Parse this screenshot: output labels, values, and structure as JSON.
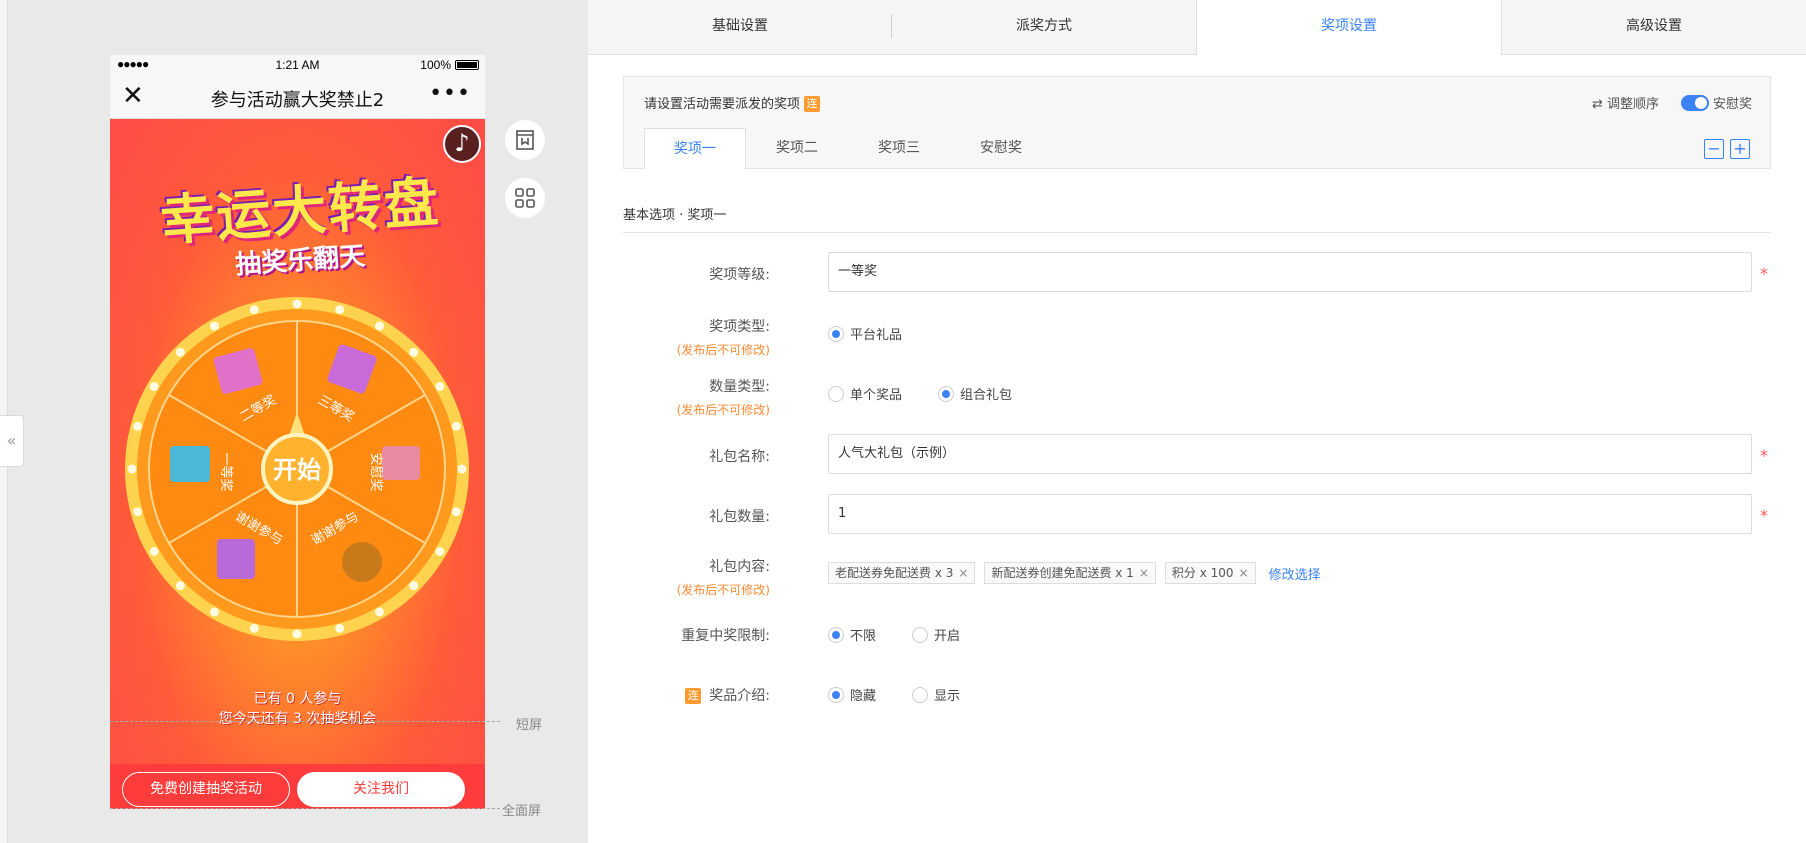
{
  "phone": {
    "carrier_dots": "●●●●●",
    "time": "1:21 AM",
    "battery": "100%",
    "title": "参与活动赢大奖禁止2",
    "close": "✕",
    "more": "•••"
  },
  "game": {
    "title_big": "幸运大转盘",
    "title_sub": "抽奖乐翻天",
    "start": "开始",
    "music": "♪",
    "prizes": [
      "三等奖",
      "安慰奖",
      "谢谢参与",
      "谢谢参与",
      "一等奖",
      "二等奖"
    ],
    "participants_line1": "已有 0 人参与",
    "participants_line2": "您今天还有 3 次抽奖机会"
  },
  "phone_buttons": {
    "create": "免费创建抽奖活动",
    "follow": "关注我们"
  },
  "side_labels": {
    "short": "短屏",
    "full": "全面屏"
  },
  "collapse": "«",
  "tabs": [
    "基础设置",
    "派奖方式",
    "奖项设置",
    "高级设置"
  ],
  "active_tab": 2,
  "card": {
    "header": "请设置活动需要派发的奖项",
    "badge": "连",
    "reorder": "⇄ 调整顺序",
    "consolation_toggle": "安慰奖",
    "subtabs": [
      "奖项一",
      "奖项二",
      "奖项三",
      "安慰奖"
    ],
    "minus": "−",
    "plus": "+"
  },
  "section_title": "基本选项 · 奖项一",
  "form": {
    "level_label": "奖项等级:",
    "level_value": "一等奖",
    "type_label": "奖项类型:",
    "note": "(发布后不可修改)",
    "type_option": "平台礼品",
    "qty_type_label": "数量类型:",
    "qty_opt1": "单个奖品",
    "qty_opt2": "组合礼包",
    "pack_name_label": "礼包名称:",
    "pack_name_value": "人气大礼包（示例）",
    "pack_qty_label": "礼包数量:",
    "pack_qty_value": "1",
    "pack_content_label": "礼包内容:",
    "chips": [
      "老配送券免配送费 x 3",
      "新配送券创建免配送费 x 1",
      "积分 x 100"
    ],
    "modify": "修改选择",
    "repeat_label": "重复中奖限制:",
    "repeat_opt1": "不限",
    "repeat_opt2": "开启",
    "intro_label": "奖品介绍:",
    "intro_opt1": "隐藏",
    "intro_opt2": "显示",
    "required": "*"
  }
}
